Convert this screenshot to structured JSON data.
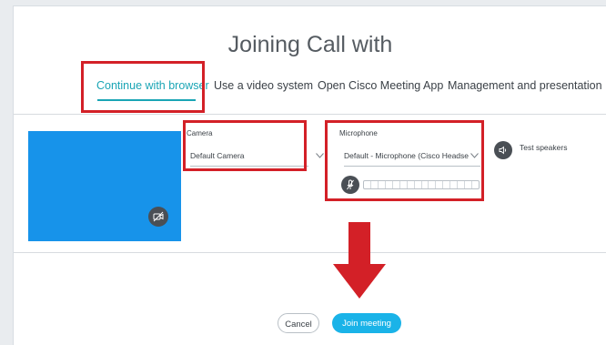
{
  "dialog": {
    "title": "Joining Call with"
  },
  "tabs": [
    {
      "label": "Continue with browser",
      "active": true
    },
    {
      "label": "Use a video system",
      "active": false
    },
    {
      "label": "Open Cisco Meeting App",
      "active": false
    },
    {
      "label": "Management and presentation",
      "active": false
    }
  ],
  "camera": {
    "label": "Camera",
    "value": "Default Camera"
  },
  "microphone": {
    "label": "Microphone",
    "value": "Default - Microphone (Cisco Headse",
    "level": 0
  },
  "speakers": {
    "label": "Test speakers"
  },
  "actions": {
    "cancel": "Cancel",
    "join": "Join meeting"
  },
  "colors": {
    "accent": "#1aa5b5",
    "join_button": "#1ab3e8",
    "preview": "#1793ea",
    "highlight": "#d32027"
  },
  "icons": [
    "camera-off-icon",
    "chevron-down-icon",
    "mic-mute-icon",
    "speaker-icon",
    "red-arrow-down-icon"
  ]
}
